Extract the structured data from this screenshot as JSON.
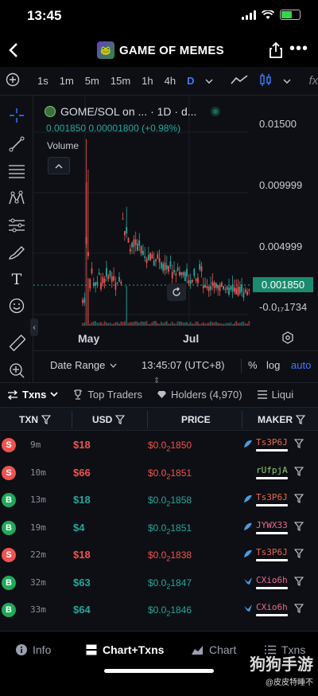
{
  "status_bar": {
    "time": "13:45"
  },
  "header": {
    "title": "GAME OF MEMES"
  },
  "toolbar": {
    "intervals": [
      "1s",
      "1m",
      "5m",
      "15m",
      "1h",
      "4h",
      "D"
    ],
    "active_interval": "D",
    "fx_label": "fx"
  },
  "chart": {
    "symbol": "GOME/SOL on ... · 1D · d...",
    "ohlc_line": "0.001850  0.00001800 (+0.98%)",
    "volume_label": "Volume",
    "y_ticks": [
      "0.01500",
      "0.009999",
      "0.004999",
      "-0.0₁₇1734"
    ],
    "last_price": "0.001850",
    "x_ticks": [
      "May",
      "Jul"
    ],
    "colors": {
      "up": "#26a69a",
      "down": "#ef5350",
      "accent": "#3d7bfd"
    }
  },
  "chart_data": {
    "type": "candlestick",
    "x_ticks": [
      "May",
      "Jul"
    ],
    "last_price": 0.00185,
    "ylim": [
      -0.0001734,
      0.016
    ],
    "y_ticks": [
      0.015,
      0.009999,
      0.004999,
      -0.0001734
    ]
  },
  "range_bar": {
    "date_range": "Date Range",
    "clock": "13:45:07 (UTC+8)",
    "percent": "%",
    "log": "log",
    "auto": "auto"
  },
  "tabs": [
    {
      "label": "Txns",
      "icon": "exchange-icon",
      "active": true
    },
    {
      "label": "Top Traders",
      "icon": "trophy-icon",
      "active": false
    },
    {
      "label": "Holders (4,970)",
      "icon": "diamond-icon",
      "active": false
    },
    {
      "label": "Liqui",
      "icon": "list-icon",
      "active": false
    }
  ],
  "table": {
    "columns": [
      "TXN",
      "USD",
      "PRICE",
      "MAKER"
    ],
    "rows": [
      {
        "type": "S",
        "side": "sell",
        "age": "9m",
        "usd": "$18",
        "price_pre": "$0.0",
        "price_sub": "2",
        "price_post": "1850",
        "maker": "Ts3P6J",
        "maker_color": "#e8694a",
        "icon": "fish-icon"
      },
      {
        "type": "S",
        "side": "sell",
        "age": "10m",
        "usd": "$66",
        "price_pre": "$0.0",
        "price_sub": "2",
        "price_post": "1851",
        "maker": "rUfpjA",
        "maker_color": "#8ec96a",
        "icon": ""
      },
      {
        "type": "B",
        "side": "buy",
        "age": "13m",
        "usd": "$18",
        "price_pre": "$0.0",
        "price_sub": "2",
        "price_post": "1858",
        "maker": "Ts3P6J",
        "maker_color": "#e8694a",
        "icon": "fish-icon"
      },
      {
        "type": "B",
        "side": "buy",
        "age": "19m",
        "usd": "$4",
        "price_pre": "$0.0",
        "price_sub": "2",
        "price_post": "1851",
        "maker": "JYWX33",
        "maker_color": "#e86a8a",
        "icon": "fish-icon"
      },
      {
        "type": "S",
        "side": "sell",
        "age": "22m",
        "usd": "$18",
        "price_pre": "$0.0",
        "price_sub": "2",
        "price_post": "1838",
        "maker": "Ts3P6J",
        "maker_color": "#e8694a",
        "icon": "fish-icon"
      },
      {
        "type": "B",
        "side": "buy",
        "age": "32m",
        "usd": "$63",
        "price_pre": "$0.0",
        "price_sub": "2",
        "price_post": "1847",
        "maker": "CXio6h",
        "maker_color": "#e86a8a",
        "icon": "bird-icon"
      },
      {
        "type": "B",
        "side": "buy",
        "age": "33m",
        "usd": "$64",
        "price_pre": "$0.0",
        "price_sub": "2",
        "price_post": "1846",
        "maker": "CXio6h",
        "maker_color": "#e86a8a",
        "icon": "bird-icon"
      }
    ]
  },
  "bottom_nav": [
    {
      "label": "Info",
      "icon": "info-icon",
      "active": false
    },
    {
      "label": "Chart+Txns",
      "icon": "split-view-icon",
      "active": true
    },
    {
      "label": "Chart",
      "icon": "chart-icon",
      "active": false
    },
    {
      "label": "Txns",
      "icon": "list-icon",
      "active": false
    }
  ],
  "watermark": {
    "title": "狗狗手游",
    "sub": "@皮皮特睡不"
  }
}
